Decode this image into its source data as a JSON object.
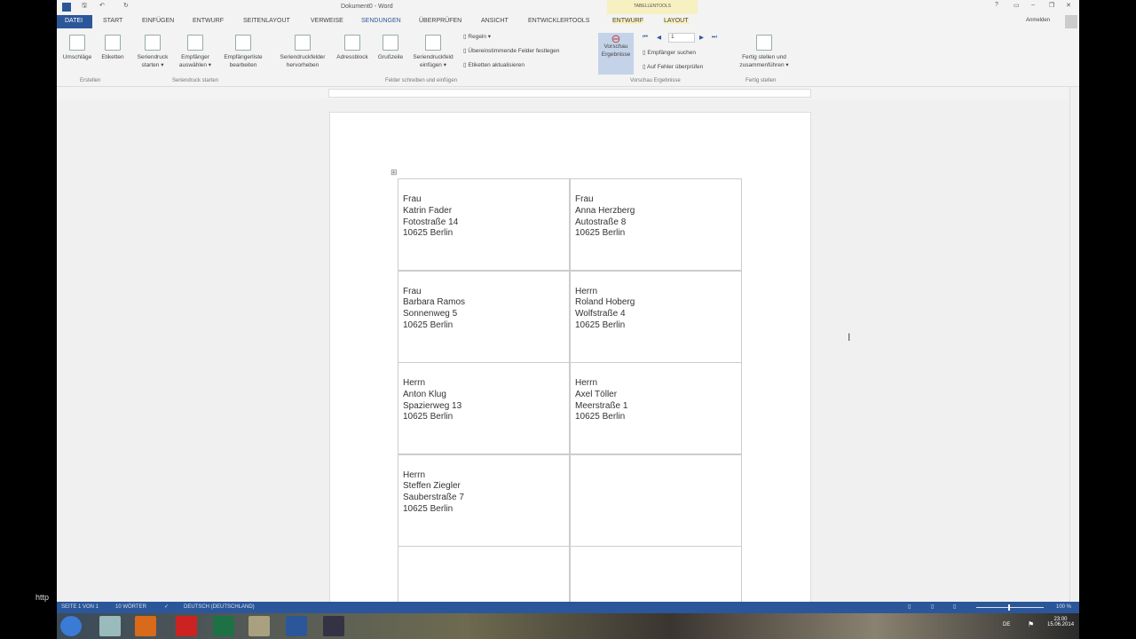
{
  "window": {
    "title": "Dokument0 - Word",
    "signin": "Anmelden",
    "context_tab_group": "TABELLENTOOLS"
  },
  "tabs": [
    "DATEI",
    "START",
    "EINFÜGEN",
    "ENTWURF",
    "SEITENLAYOUT",
    "VERWEISE",
    "SENDUNGEN",
    "ÜBERPRÜFEN",
    "ANSICHT",
    "ENTWICKLERTOOLS",
    "ENTWURF",
    "LAYOUT"
  ],
  "ribbon": {
    "buttons": [
      "Umschläge",
      "Etiketten",
      "Seriendruck starten ▾",
      "Empfänger auswählen ▾",
      "Empfängerliste bearbeiten",
      "Seriendruckfelder hervorheben",
      "Adressblock",
      "Grußzeile",
      "Seriendruckfeld einfügen ▾",
      "Vorschau Ergebnisse",
      "Fertig stellen und zusammenführen ▾"
    ],
    "small": [
      "Regeln ▾",
      "Übereinstimmende Felder festlegen",
      "Etiketten aktualisieren",
      "Empfänger suchen",
      "Auf Fehler überprüfen"
    ],
    "record": "1",
    "groups": [
      "Erstellen",
      "Seriendruck starten",
      "Felder schreiben und einfügen",
      "Vorschau Ergebnisse",
      "Fertig stellen"
    ]
  },
  "labels": [
    [
      "Frau",
      "Katrin Fader",
      "Fotostraße 14",
      "10625 Berlin"
    ],
    [
      "Frau",
      "Anna Herzberg",
      "Autostraße 8",
      "10625 Berlin"
    ],
    [
      "Frau",
      "Barbara Ramos",
      "Sonnenweg 5",
      "10625 Berlin"
    ],
    [
      "Herrn",
      "Roland Hoberg",
      "Wolfstraße 4",
      "10625 Berlin"
    ],
    [
      "Herrn",
      "Anton Klug",
      "Spazierweg 13",
      "10625 Berlin"
    ],
    [
      "Herrn",
      "Axel Töller",
      "Meerstraße 1",
      "10625 Berlin"
    ],
    [
      "Herrn",
      "Steffen Ziegler",
      "Sauberstraße 7",
      "10625 Berlin"
    ],
    [],
    [],
    []
  ],
  "status": {
    "page": "SEITE 1 VON 1",
    "words": "10 WÖRTER",
    "language": "DEUTSCH (DEUTSCHLAND)",
    "zoom": "100 %"
  },
  "taskbar": {
    "time": "23:00",
    "date": "15.06.2014",
    "lang": "DE"
  },
  "watermark": "http"
}
